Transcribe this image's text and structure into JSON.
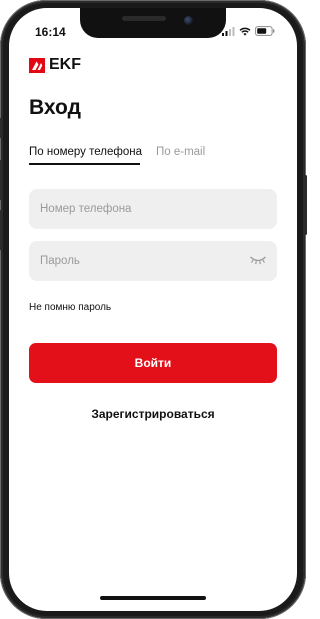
{
  "status_bar": {
    "time": "16:14"
  },
  "brand": {
    "logo_text": "EKF",
    "accent_color": "#e30613"
  },
  "page": {
    "title": "Вход"
  },
  "tabs": [
    {
      "label": "По номеру телефона",
      "active": true
    },
    {
      "label": "По e-mail",
      "active": false
    }
  ],
  "form": {
    "phone": {
      "value": "",
      "placeholder": "Номер телефона"
    },
    "password": {
      "value": "",
      "placeholder": "Пароль",
      "icon": "eye-closed-icon"
    },
    "forgot_label": "Не помню пароль",
    "submit_label": "Войти",
    "submit_color": "#e3101a",
    "register_label": "Зарегистрироваться"
  }
}
